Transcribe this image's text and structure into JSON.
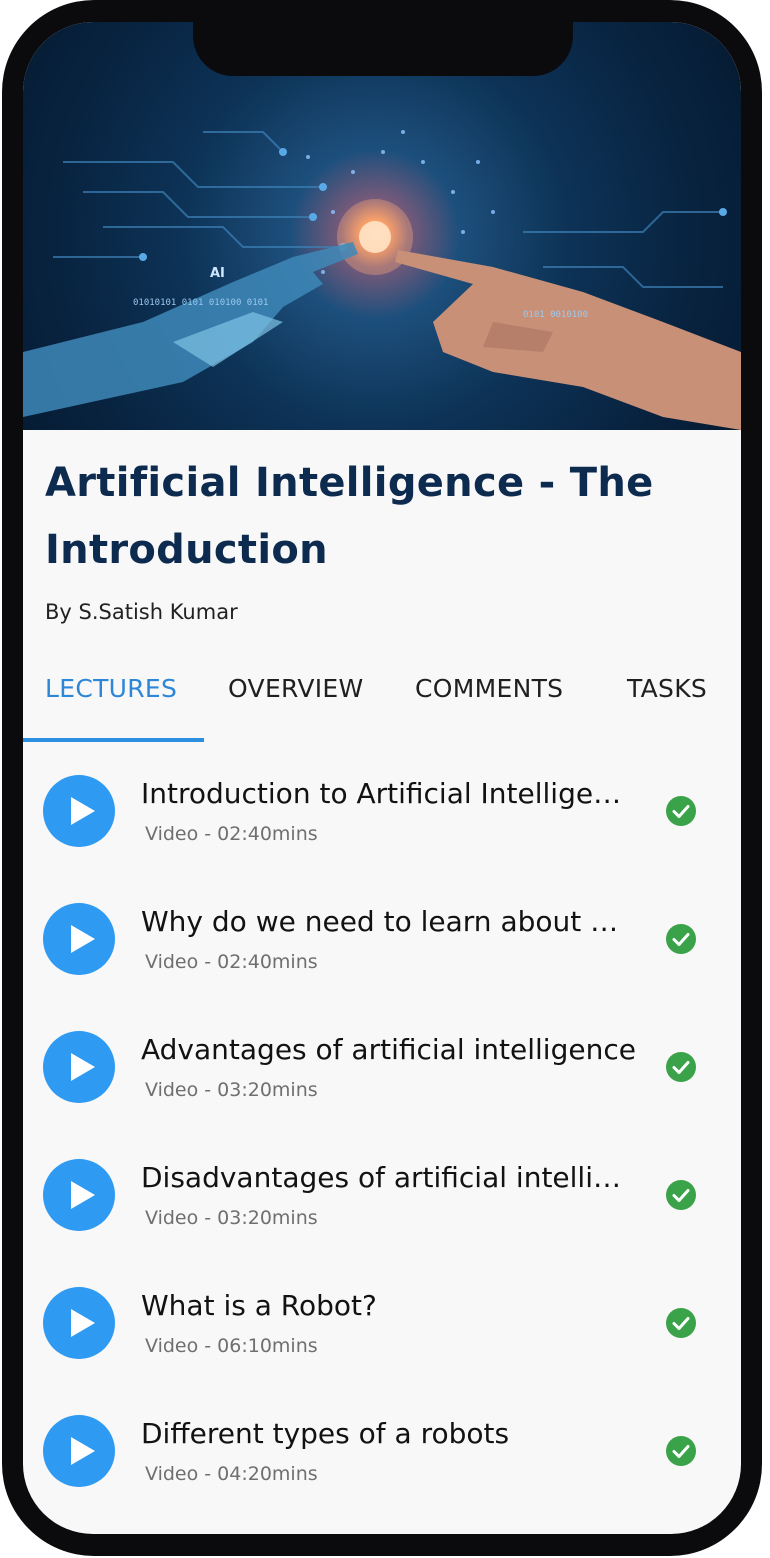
{
  "course": {
    "title": "Artificial Intelligence - The Introduction",
    "author": "By S.Satish Kumar",
    "hero_caption": "AI"
  },
  "tabs": [
    {
      "label": "LECTURES",
      "active": true
    },
    {
      "label": "OVERVIEW",
      "active": false
    },
    {
      "label": "COMMENTS",
      "active": false
    },
    {
      "label": "TASKS",
      "active": false
    }
  ],
  "lectures": [
    {
      "title": "Introduction to Artificial Intelligence",
      "meta": "Video - 02:40mins",
      "completed": true
    },
    {
      "title": "Why do we need to learn about Artificial Intelligence",
      "meta": "Video - 02:40mins",
      "completed": true
    },
    {
      "title": "Advantages of artificial intelligence",
      "meta": "Video - 03:20mins",
      "completed": true
    },
    {
      "title": "Disadvantages of artificial intelligence",
      "meta": "Video - 03:20mins",
      "completed": true
    },
    {
      "title": "What is a Robot?",
      "meta": "Video - 06:10mins",
      "completed": true
    },
    {
      "title": "Different types of a robots",
      "meta": "Video - 04:20mins",
      "completed": true
    }
  ],
  "colors": {
    "accent": "#2d87d6",
    "play_button": "#2e9af2",
    "check": "#3aa34a",
    "title": "#0d2a4f"
  }
}
